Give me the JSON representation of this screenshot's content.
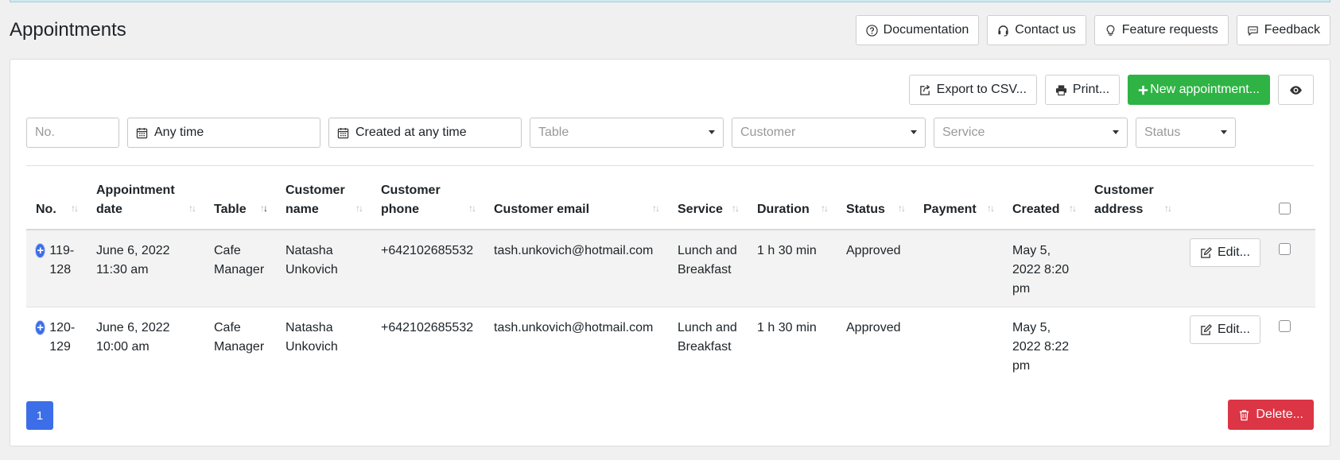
{
  "page": {
    "title": "Appointments"
  },
  "help": {
    "documentation": "Documentation",
    "contact": "Contact us",
    "features": "Feature requests",
    "feedback": "Feedback"
  },
  "toolbar": {
    "export": "Export to CSV...",
    "print": "Print...",
    "new": "New appointment..."
  },
  "filters": {
    "no_placeholder": "No.",
    "date": "Any time",
    "created": "Created at any time",
    "table": "Table",
    "customer": "Customer",
    "service": "Service",
    "status": "Status"
  },
  "table": {
    "headers": {
      "no": "No.",
      "date": "Appointment date",
      "table": "Table",
      "customer_name": "Customer name",
      "customer_phone": "Customer phone",
      "customer_email": "Customer email",
      "service": "Service",
      "duration": "Duration",
      "status": "Status",
      "payment": "Payment",
      "created": "Created",
      "customer_address": "Customer address"
    },
    "rows": [
      {
        "no": "119-128",
        "date": "June 6, 2022 11:30 am",
        "table": "Cafe Manager",
        "name": "Natasha Unkovich",
        "phone": "+642102685532",
        "email": "tash.unkovich@hotmail.com",
        "service": "Lunch and Breakfast",
        "duration": "1 h 30 min",
        "status": "Approved",
        "payment": "",
        "created": "May 5, 2022 8:20 pm",
        "address": "",
        "edit": "Edit..."
      },
      {
        "no": "120-129",
        "date": "June 6, 2022 10:00 am",
        "table": "Cafe Manager",
        "name": "Natasha Unkovich",
        "phone": "+642102685532",
        "email": "tash.unkovich@hotmail.com",
        "service": "Lunch and Breakfast",
        "duration": "1 h 30 min",
        "status": "Approved",
        "payment": "",
        "created": "May 5, 2022 8:22 pm",
        "address": "",
        "edit": "Edit..."
      }
    ]
  },
  "pagination": {
    "current": "1"
  },
  "actions": {
    "delete": "Delete..."
  },
  "colors": {
    "primary": "#3c6ee8",
    "success": "#2fb344",
    "danger": "#dc3545"
  }
}
